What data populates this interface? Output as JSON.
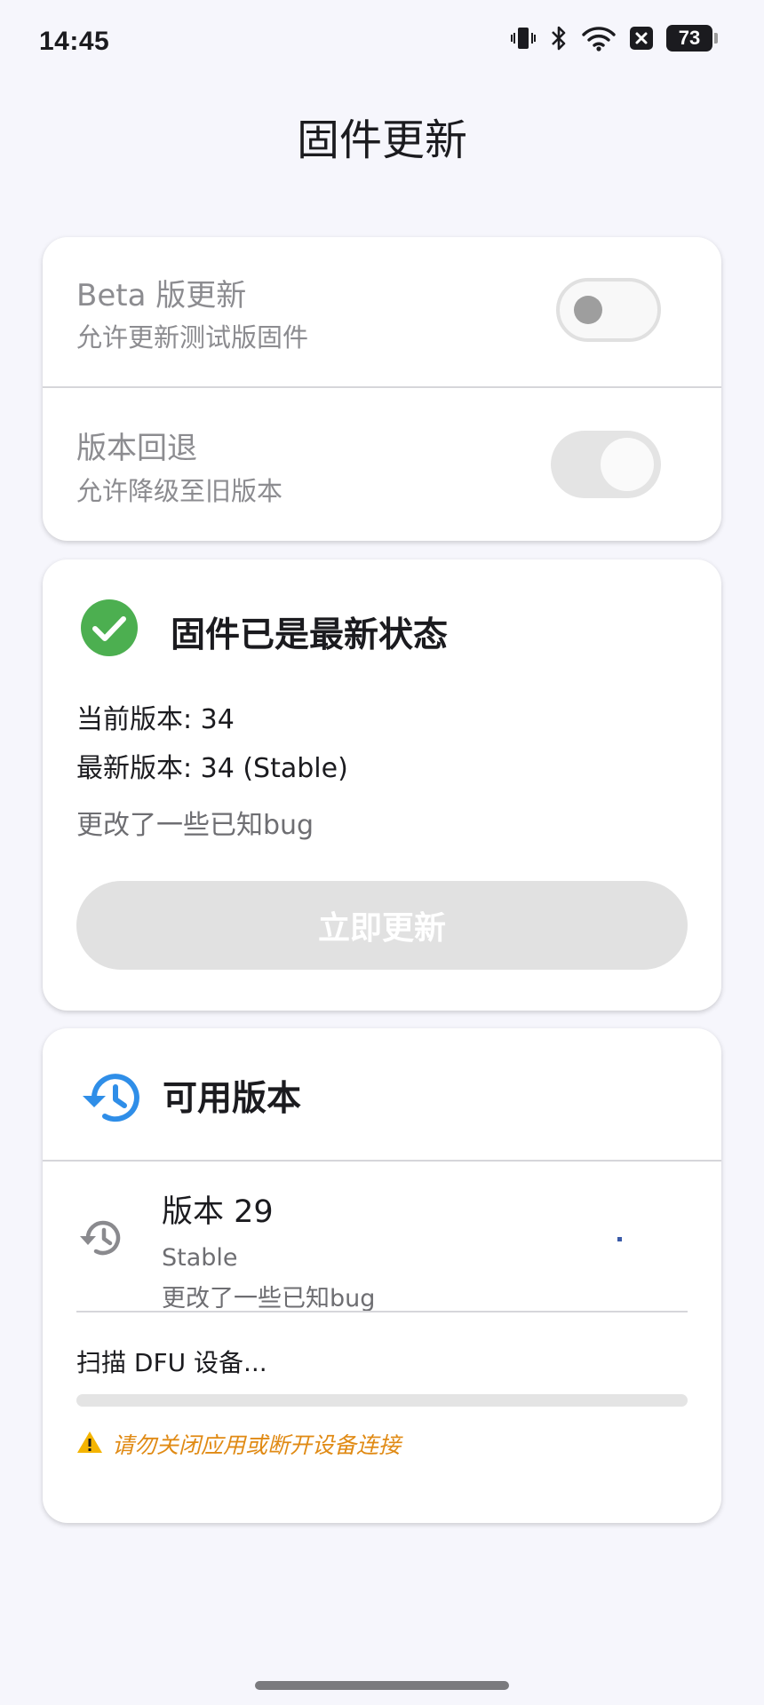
{
  "status_bar": {
    "time": "14:45",
    "battery": "73",
    "icons": [
      "vibrate-icon",
      "bluetooth-icon",
      "wifi-icon",
      "close-box-icon",
      "battery-icon"
    ]
  },
  "page_title": "固件更新",
  "settings": {
    "beta": {
      "title": "Beta 版更新",
      "subtitle": "允许更新测试版固件",
      "enabled": false
    },
    "rollback": {
      "title": "版本回退",
      "subtitle": "允许降级至旧版本",
      "enabled": true
    }
  },
  "status_card": {
    "icon": "check-circle-icon",
    "title": "固件已是最新状态",
    "current_version": "当前版本: 34",
    "latest_version": "最新版本: 34 (Stable)",
    "notes": "更改了一些已知bug",
    "update_button": "立即更新"
  },
  "versions_card": {
    "icon": "history-icon",
    "title": "可用版本",
    "items": [
      {
        "title": "版本 29",
        "channel": "Stable",
        "notes": "更改了一些已知bug"
      }
    ],
    "dfu_status": "扫描 DFU 设备...",
    "progress": 0,
    "warning": "请勿关闭应用或断开设备连接"
  },
  "colors": {
    "background": "#f6f6fc",
    "success": "#4caf50",
    "accent": "#2f8ee8",
    "warning": "#e08a14"
  }
}
